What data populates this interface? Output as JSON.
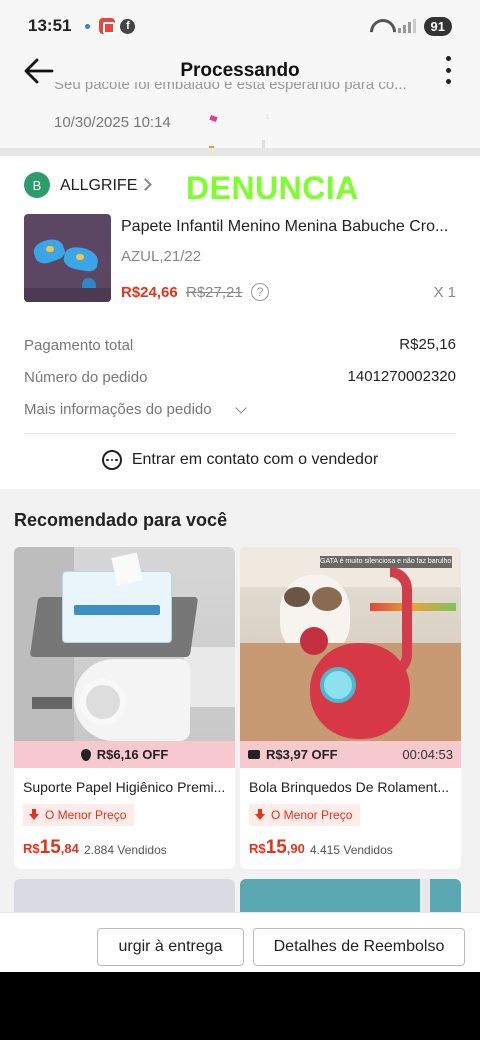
{
  "status_bar": {
    "time": "13:51",
    "battery": "91"
  },
  "header": {
    "title": "Processando",
    "cut_text": "Seu pacote foi embalado e está esperando para co...",
    "timestamp": "10/30/2025 10:14"
  },
  "order": {
    "shop_initial": "B",
    "shop_name": "ALLGRIFE",
    "overlay_text": "DENUNCIA",
    "product_title": "Papete Infantil Menino Menina Babuche Cro...",
    "variant": "AZUL,21/22",
    "price_current": "R$24,66",
    "price_old": "R$27,21",
    "help_glyph": "?",
    "quantity": "X 1",
    "payment_label": "Pagamento total",
    "payment_value": "R$25,16",
    "order_number_label": "Número do pedido",
    "order_number_value": "1401270002320",
    "more_info_label": "Mais informações do pedido",
    "contact_label": "Entrar em contato com o vendedor"
  },
  "recommendations": {
    "title": "Recomendado para você",
    "items": [
      {
        "discount": "R$6,16 OFF",
        "name": "Suporte Papel Higiênico Premi...",
        "badge": "O Menor Preço",
        "price_currency": "R$",
        "price_int": "15",
        "price_dec": ",84",
        "sold": "2.884 Vendidos",
        "strip_color": "#f6c9cf"
      },
      {
        "discount": "R$3,97 OFF",
        "timer": "00:04:53",
        "image_caption": "GATA é muito silenciosa e não faz barulho",
        "name": "Bola Brinquedos De Rolament...",
        "badge": "O Menor Preço",
        "price_currency": "R$",
        "price_int": "15",
        "price_dec": ",90",
        "sold": "4.415 Vendidos",
        "strip_color": "#f6c9cf"
      }
    ]
  },
  "actions": {
    "confirm_delivery": "urgir à entrega",
    "refund_details": "Detalhes de Reembolso"
  },
  "colors": {
    "accent_red": "#e8311a",
    "overlay_green": "#7cff2a",
    "shop_avatar": "#2a9d6a"
  }
}
